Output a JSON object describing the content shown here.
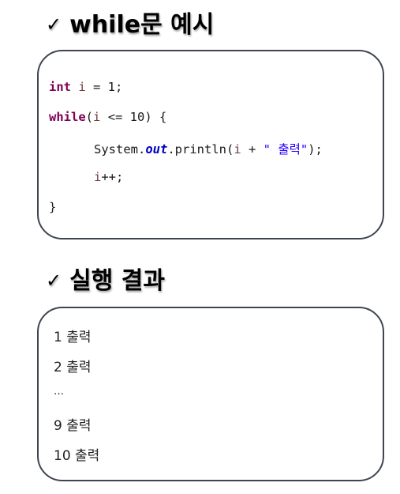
{
  "headings": {
    "check_icon": "✓",
    "example_title": "while문 예시",
    "result_title": "실행 결과"
  },
  "code": {
    "language": "java",
    "colors": {
      "keyword": "#7f0055",
      "variable": "#6a3e3e",
      "field": "#0000c0",
      "string": "#2a00ff"
    },
    "lines": [
      {
        "tokens": [
          {
            "type": "kw",
            "text": "int"
          },
          {
            "type": "plain",
            "text": " "
          },
          {
            "type": "var",
            "text": "i"
          },
          {
            "type": "plain",
            "text": " = 1;"
          }
        ]
      },
      {
        "tokens": [
          {
            "type": "kw",
            "text": "while"
          },
          {
            "type": "plain",
            "text": "("
          },
          {
            "type": "var",
            "text": "i"
          },
          {
            "type": "plain",
            "text": " <= 10) {"
          }
        ]
      },
      {
        "tokens": [
          {
            "type": "plain",
            "text": "System."
          },
          {
            "type": "field",
            "text": "out"
          },
          {
            "type": "plain",
            "text": ".println("
          },
          {
            "type": "var",
            "text": "i"
          },
          {
            "type": "plain",
            "text": " + "
          },
          {
            "type": "str",
            "text": "\" 출력\""
          },
          {
            "type": "plain",
            "text": ");"
          }
        ]
      },
      {
        "tokens": [
          {
            "type": "var",
            "text": "i"
          },
          {
            "type": "plain",
            "text": "++;"
          }
        ]
      },
      {
        "tokens": [
          {
            "type": "plain",
            "text": "}"
          }
        ]
      }
    ]
  },
  "output": {
    "lines": [
      "1 출력",
      "2 출력",
      "…",
      "9 출력",
      "10 출력"
    ]
  }
}
